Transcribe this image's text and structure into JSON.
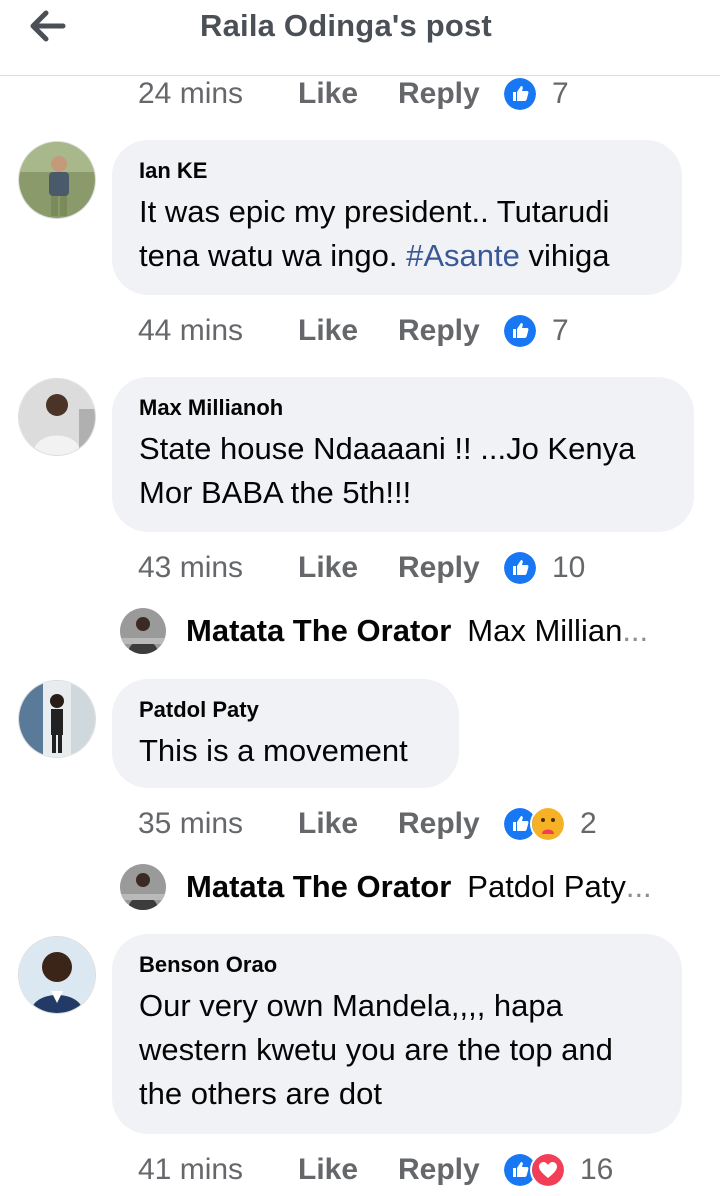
{
  "header": {
    "title": "Raila Odinga's post",
    "back_icon": "arrow-left-icon"
  },
  "colors": {
    "like_blue": "#1877f2",
    "love_red": "#f33e58",
    "care_yellow": "#f7b125",
    "bubble": "#f0f2f5",
    "hashtag": "#385898"
  },
  "prev_comment": {
    "time": "24 mins",
    "like": "Like",
    "reply": "Reply",
    "reaction_count": "7"
  },
  "comments": [
    {
      "name": "Ian KE",
      "text_before": "It was epic my president.. Tutarudi tena watu wa ingo. ",
      "hashtag": "#Asante",
      "text_after": " vihiga",
      "time": "44 mins",
      "like": "Like",
      "reply": "Reply",
      "reaction_count": "7"
    },
    {
      "name": "Max Millianoh",
      "text": "State house Ndaaaani !! ...Jo Kenya Mor BABA the 5th!!!",
      "time": "43 mins",
      "like": "Like",
      "reply": "Reply",
      "reaction_count": "10",
      "reply_preview": {
        "name": "Matata The Orator",
        "text": "Max Millian",
        "ellipsis": "..."
      }
    },
    {
      "name": "Patdol Paty",
      "text": "This is a movement",
      "time": "35 mins",
      "like": "Like",
      "reply": "Reply",
      "reaction_count": "2",
      "reply_preview": {
        "name": "Matata The Orator",
        "text": "Patdol Paty",
        "ellipsis": "..."
      }
    },
    {
      "name": "Benson Orao",
      "text": "Our very own Mandela,,,, hapa western kwetu you are the top and the others are dot",
      "time": "41 mins",
      "like": "Like",
      "reply": "Reply",
      "reaction_count": "16"
    }
  ]
}
